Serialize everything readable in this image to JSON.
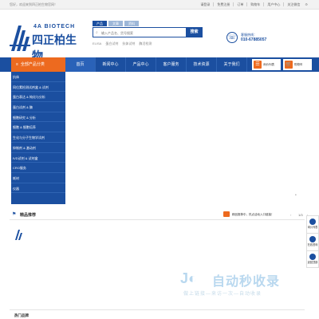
{
  "topbar": {
    "welcome": "您好，欢迎来到四正柏生物官网！",
    "links": [
      "请登录",
      "免费注册",
      "订单",
      "购物车",
      "用户中心",
      "关注微信"
    ]
  },
  "logo": {
    "en": "4A BIOTECH",
    "cn": "四正柏生物"
  },
  "search": {
    "tabs": [
      "产品",
      "文章",
      "资料"
    ],
    "placeholder": "输入产品名、货号搜索",
    "button": "搜索",
    "hotwords": [
      "ELISA",
      "蛋白试剂",
      "抗体试剂",
      "酶活检测"
    ]
  },
  "hotline": {
    "label": "客服热线：",
    "number": "010-67885057"
  },
  "nav": {
    "category_label": "全部产品分类",
    "items": [
      "首页",
      "新闻中心",
      "产品中心",
      "客户服务",
      "技术资源",
      "关于我们"
    ],
    "cart1": "询价列表",
    "cart2": "购物车"
  },
  "categories": [
    "抗体",
    "同位素检测试剂盒 & 试剂",
    "蛋白表达 & 纯化与分析",
    "蛋白试剂 & 酶",
    "细胞研究 & 分析",
    "细胞 & 细胞培养",
    "生化与分子生物学试剂",
    "抑制剂 & 激动剂",
    "IVD试剂 & 试剂盒",
    "CRO服务",
    "耗材",
    "仪器"
  ],
  "recommend": {
    "title": "精品推荐",
    "notice": "精品推荐中，热点活动入口链接！",
    "pager": "1/3"
  },
  "float": [
    "询价列表",
    "在线咨询",
    "返回顶部"
  ],
  "watermark": {
    "brand": "自动秒收录",
    "slogan": "做上链接—来访一次—自动收录"
  },
  "bottom": {
    "title": "热门品牌"
  },
  "colors": {
    "primary": "#1b4fa0",
    "accent": "#ed6a1f"
  }
}
